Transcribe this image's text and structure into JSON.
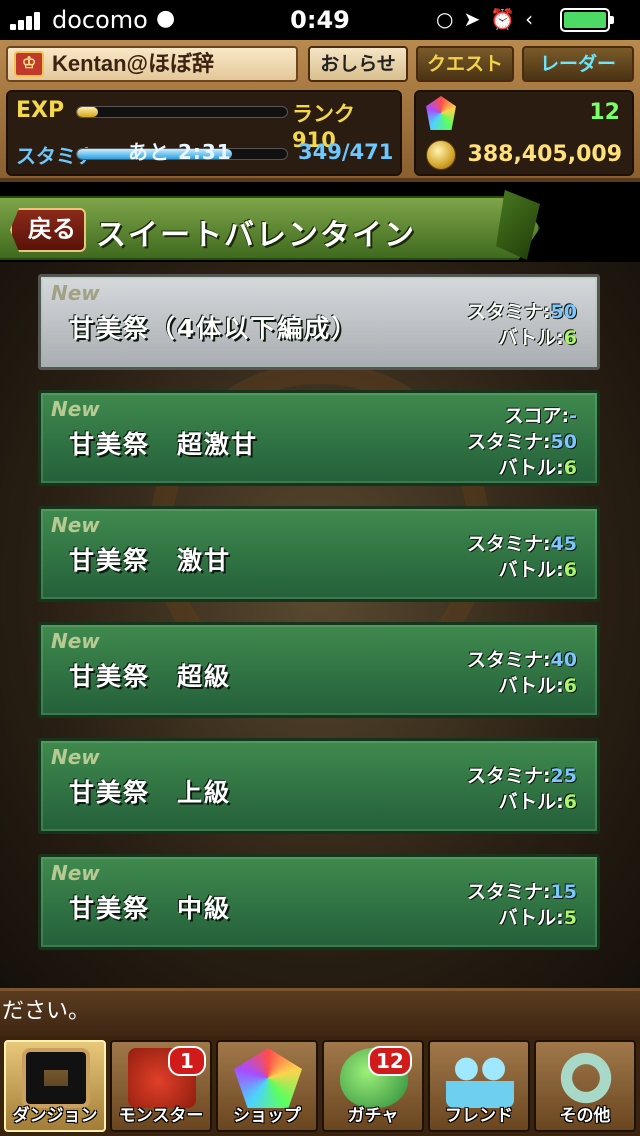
{
  "status_bar": {
    "carrier": "docomo",
    "time": "0:49",
    "icons": [
      "signal-icon",
      "wifi-icon",
      "lock-rotation-icon",
      "location-icon",
      "alarm-icon",
      "bluetooth-icon",
      "battery-icon"
    ]
  },
  "header": {
    "player_name": "Kentan@ほぼ辞",
    "buttons": {
      "news": "おしらせ",
      "quest": "クエスト",
      "radar": "レーダー"
    },
    "exp_label": "EXP",
    "exp_progress": 0.1,
    "rank": "ランク 910",
    "stamina_label": "スタミナ",
    "stamina_timer": "あと 2:31",
    "stamina_value": "349/471",
    "stamina_progress": 0.74,
    "magic_stones": "12",
    "coins": "388,405,009"
  },
  "title_bar": {
    "back_label": "戻る",
    "title": "スイートバレンタイン"
  },
  "dungeons": [
    {
      "new": "New",
      "name": "甘美祭（4体以下編成）",
      "style": "grey",
      "stamina_label": "スタミナ:",
      "stamina": "50",
      "battle_label": "バトル:",
      "battles": "6"
    },
    {
      "new": "New",
      "name": "甘美祭　超激甘",
      "style": "green",
      "score_label": "スコア:",
      "score": "-",
      "stamina_label": "スタミナ:",
      "stamina": "50",
      "battle_label": "バトル:",
      "battles": "6"
    },
    {
      "new": "New",
      "name": "甘美祭　激甘",
      "style": "green",
      "stamina_label": "スタミナ:",
      "stamina": "45",
      "battle_label": "バトル:",
      "battles": "6"
    },
    {
      "new": "New",
      "name": "甘美祭　超級",
      "style": "green",
      "stamina_label": "スタミナ:",
      "stamina": "40",
      "battle_label": "バトル:",
      "battles": "6"
    },
    {
      "new": "New",
      "name": "甘美祭　上級",
      "style": "green",
      "stamina_label": "スタミナ:",
      "stamina": "25",
      "battle_label": "バトル:",
      "battles": "6"
    },
    {
      "new": "New",
      "name": "甘美祭　中級",
      "style": "green",
      "stamina_label": "スタミナ:",
      "stamina": "15",
      "battle_label": "バトル:",
      "battles": "5"
    }
  ],
  "message": "ださい。",
  "bottom_nav": [
    {
      "label": "ダンジョン",
      "icon": "dungeon-gate-icon",
      "active": true
    },
    {
      "label": "モンスター",
      "icon": "monster-dragon-icon",
      "badge": "1"
    },
    {
      "label": "ショップ",
      "icon": "rainbow-stone-icon"
    },
    {
      "label": "ガチャ",
      "icon": "egg-icon",
      "badge": "12"
    },
    {
      "label": "フレンド",
      "icon": "friends-icon"
    },
    {
      "label": "その他",
      "icon": "question-mark-icon"
    }
  ],
  "colors": {
    "exp": "#f5d84a",
    "stamina": "#6cc8ff",
    "dungeon_green": "#3f8a4e",
    "badge_red": "#d11a1a"
  }
}
